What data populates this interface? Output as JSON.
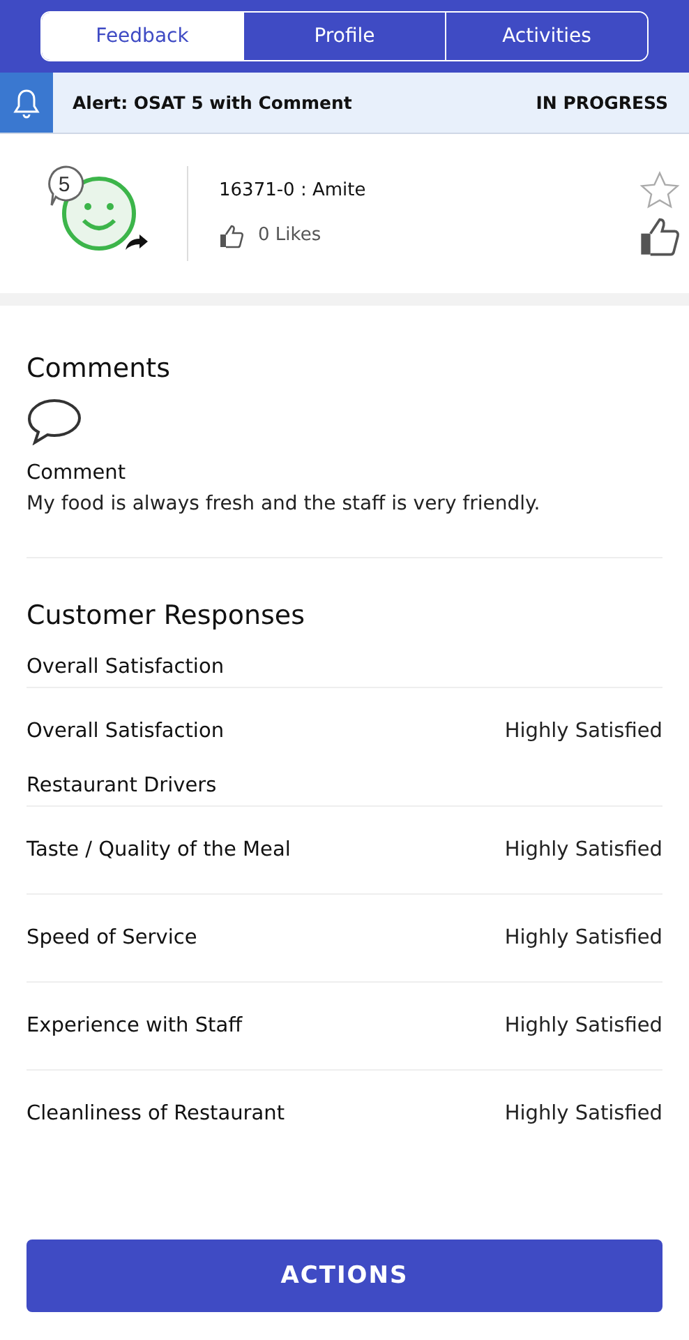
{
  "tabs": [
    {
      "label": "Feedback",
      "selected": true
    },
    {
      "label": "Profile",
      "selected": false
    },
    {
      "label": "Activities",
      "selected": false
    }
  ],
  "alert": {
    "title": "Alert: OSAT 5 with Comment",
    "status": "IN PROGRESS"
  },
  "feedback": {
    "score": "5",
    "store": "16371-0 : Amite",
    "likes": "0 Likes",
    "starred": false
  },
  "comments": {
    "heading": "Comments",
    "label": "Comment",
    "text": "My food is always fresh and the staff is very friendly."
  },
  "responses": {
    "heading": "Customer Responses",
    "items": [
      {
        "kind": "section",
        "label": "Overall Satisfaction"
      },
      {
        "kind": "answer",
        "label": "Overall Satisfaction",
        "value": "Highly Satisfied"
      },
      {
        "kind": "section",
        "label": "Restaurant Drivers"
      },
      {
        "kind": "answer",
        "label": "Taste / Quality of the Meal",
        "value": "Highly Satisfied"
      },
      {
        "kind": "answer",
        "label": "Speed of Service",
        "value": "Highly Satisfied"
      },
      {
        "kind": "answer",
        "label": "Experience with Staff",
        "value": "Highly Satisfied"
      },
      {
        "kind": "answer",
        "label": "Cleanliness of Restaurant",
        "value": "Highly Satisfied"
      }
    ]
  },
  "action_button": "ACTIONS"
}
